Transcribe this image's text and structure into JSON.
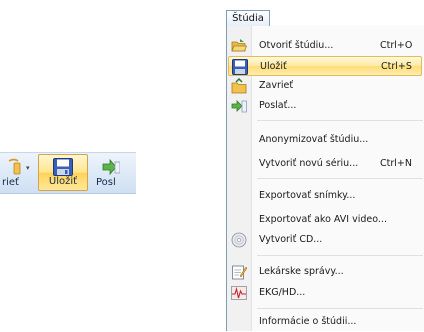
{
  "toolbar": {
    "close_label": "rieť",
    "save_label": "Uložiť",
    "send_label": "Posl"
  },
  "menu": {
    "tab_label": "Štúdia",
    "items": [
      {
        "label": "Otvoriť štúdiu...",
        "shortcut": "Ctrl+O",
        "icon": "folder-open-icon"
      },
      {
        "label": "Uložiť",
        "shortcut": "Ctrl+S",
        "icon": "save-icon",
        "highlighted": true
      },
      {
        "label": "Zavrieť",
        "shortcut": "",
        "icon": "folder-close-icon"
      },
      {
        "label": "Poslať...",
        "shortcut": "",
        "icon": "send-icon"
      },
      {
        "label": "Anonymizovať štúdiu...",
        "shortcut": "",
        "icon": ""
      },
      {
        "label": "Vytvoriť novú sériu...",
        "shortcut": "Ctrl+N",
        "icon": ""
      },
      {
        "label": "Exportovať snímky...",
        "shortcut": "",
        "icon": ""
      },
      {
        "label": "Exportovať ako AVI video...",
        "shortcut": "",
        "icon": ""
      },
      {
        "label": "Vytvoriť CD...",
        "shortcut": "",
        "icon": "cd-icon"
      },
      {
        "label": "Lekárske správy...",
        "shortcut": "",
        "icon": "report-icon"
      },
      {
        "label": "EKG/HD...",
        "shortcut": "",
        "icon": "ekg-icon"
      },
      {
        "label": "Informácie o štúdii...",
        "shortcut": "",
        "icon": ""
      }
    ]
  }
}
